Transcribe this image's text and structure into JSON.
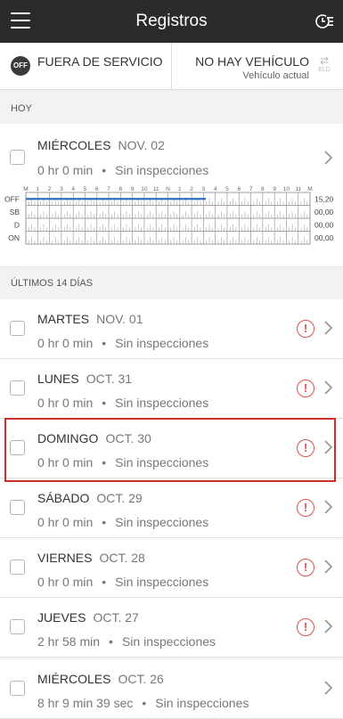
{
  "header": {
    "title": "Registros",
    "menu_icon": "hamburger-menu-icon",
    "clock_icon": "clock-list-icon"
  },
  "status": {
    "badge": "OFF",
    "duty_status": "FUERA DE SERVICIO",
    "vehicle": "NO HAY VEHÍCULO",
    "vehicle_sub": "Vehículo actual",
    "eld_label": "ELD"
  },
  "today": {
    "section_label": "HOY",
    "day": "MIÉRCOLES",
    "date": "NOV. 02",
    "duration": "0 hr 0 min",
    "inspections": "Sin inspecciones",
    "graph": {
      "hour_labels": [
        "M",
        "1",
        "2",
        "3",
        "4",
        "5",
        "6",
        "7",
        "8",
        "9",
        "10",
        "11",
        "N",
        "1",
        "2",
        "3",
        "4",
        "5",
        "6",
        "7",
        "8",
        "9",
        "10",
        "11",
        "M"
      ],
      "rows": [
        {
          "label": "OFF",
          "total": "15,20"
        },
        {
          "label": "SB",
          "total": "00,00"
        },
        {
          "label": "D",
          "total": "00,00"
        },
        {
          "label": "ON",
          "total": "00,00"
        }
      ],
      "off_line_end_hour": 15.2,
      "line_color": "#2f6fc0"
    }
  },
  "past": {
    "section_label": "ÚLTIMOS 14 DÍAS",
    "rows": [
      {
        "day": "MARTES",
        "date": "NOV. 01",
        "duration": "0 hr 0 min",
        "inspections": "Sin inspecciones",
        "warning": true
      },
      {
        "day": "LUNES",
        "date": "OCT. 31",
        "duration": "0 hr 0 min",
        "inspections": "Sin inspecciones",
        "warning": true
      },
      {
        "day": "DOMINGO",
        "date": "OCT. 30",
        "duration": "0 hr 0 min",
        "inspections": "Sin inspecciones",
        "warning": true
      },
      {
        "day": "SÁBADO",
        "date": "OCT. 29",
        "duration": "0 hr 0 min",
        "inspections": "Sin inspecciones",
        "warning": true
      },
      {
        "day": "VIERNES",
        "date": "OCT. 28",
        "duration": "0 hr 0 min",
        "inspections": "Sin inspecciones",
        "warning": true
      },
      {
        "day": "JUEVES",
        "date": "OCT. 27",
        "duration": "2 hr 58 min",
        "inspections": "Sin inspecciones",
        "warning": true
      },
      {
        "day": "MIÉRCOLES",
        "date": "OCT. 26",
        "duration": "8 hr 9 min 39 sec",
        "inspections": "Sin inspecciones",
        "warning": false
      }
    ]
  },
  "colors": {
    "warning": "#d9534f",
    "highlight": "#c9302c"
  }
}
